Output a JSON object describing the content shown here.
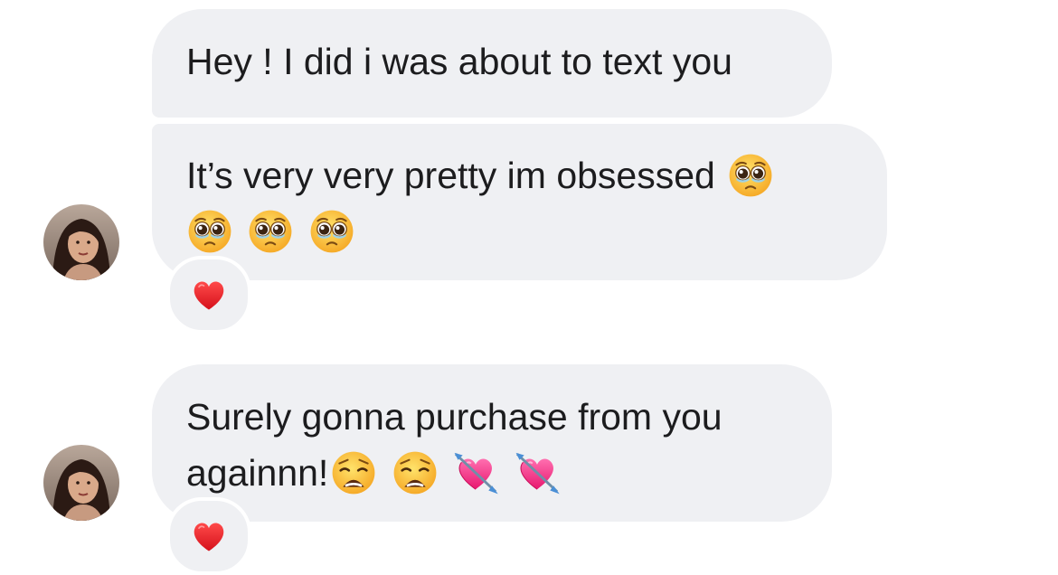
{
  "messages": [
    {
      "text_line1": "Hey ! I did i was about to text you",
      "reaction": null
    },
    {
      "text_line1": "It’s very very pretty im obsessed",
      "text_line2": "",
      "emojis_line1": [
        "pleading-face-emoji"
      ],
      "emojis_line2": [
        "pleading-face-emoji",
        "pleading-face-emoji",
        "pleading-face-emoji"
      ],
      "reaction": "red-heart-emoji"
    },
    {
      "text_line1": "Surely gonna purchase from you",
      "text_line2": "againnn!",
      "emojis_line2": [
        "weary-face-emoji",
        "weary-face-emoji",
        "heart-with-arrow-emoji",
        "heart-with-arrow-emoji"
      ],
      "reaction": "red-heart-emoji"
    }
  ],
  "colors": {
    "bubble_bg": "#eff0f3",
    "text": "#1c1c1e",
    "heart": "#e31b23"
  }
}
